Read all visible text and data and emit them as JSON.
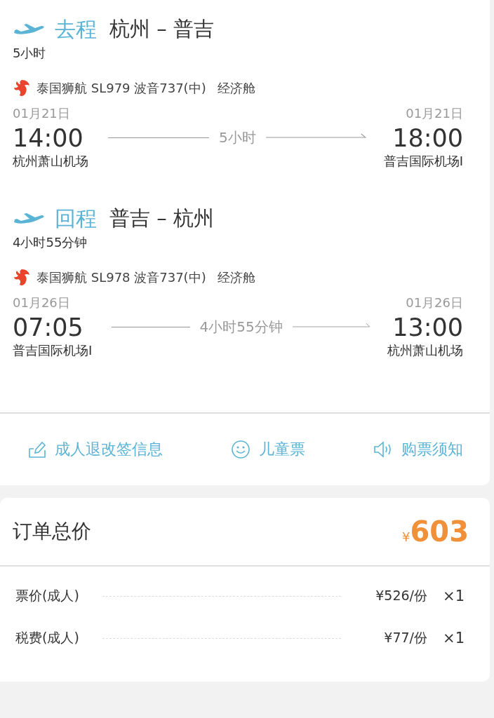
{
  "segments": [
    {
      "direction": "去程",
      "route": "杭州 – 普吉",
      "duration": "5小时",
      "airline": "泰国狮航 SL979 波音737(中)",
      "cabin": "经济舱",
      "depart": {
        "date": "01月21日",
        "time": "14:00",
        "airport": "杭州萧山机场"
      },
      "flight_time": "5小时",
      "arrive": {
        "date": "01月21日",
        "time": "18:00",
        "airport": "普吉国际机场I"
      }
    },
    {
      "direction": "回程",
      "route": "普吉 – 杭州",
      "duration": "4小时55分钟",
      "airline": "泰国狮航 SL978 波音737(中)",
      "cabin": "经济舱",
      "depart": {
        "date": "01月26日",
        "time": "07:05",
        "airport": "普吉国际机场I"
      },
      "flight_time": "4小时55分钟",
      "arrive": {
        "date": "01月26日",
        "time": "13:00",
        "airport": "杭州萧山机场"
      }
    }
  ],
  "actions": [
    {
      "kind": "edit",
      "label": "成人退改签信息"
    },
    {
      "kind": "smile",
      "label": "儿童票"
    },
    {
      "kind": "speaker",
      "label": "购票须知"
    }
  ],
  "order": {
    "title": "订单总价",
    "currency": "¥",
    "total": "603",
    "items": [
      {
        "label": "票价(成人)",
        "price": "¥526/份",
        "qty": "×1"
      },
      {
        "label": "税费(成人)",
        "price": "¥77/份",
        "qty": "×1"
      }
    ]
  }
}
